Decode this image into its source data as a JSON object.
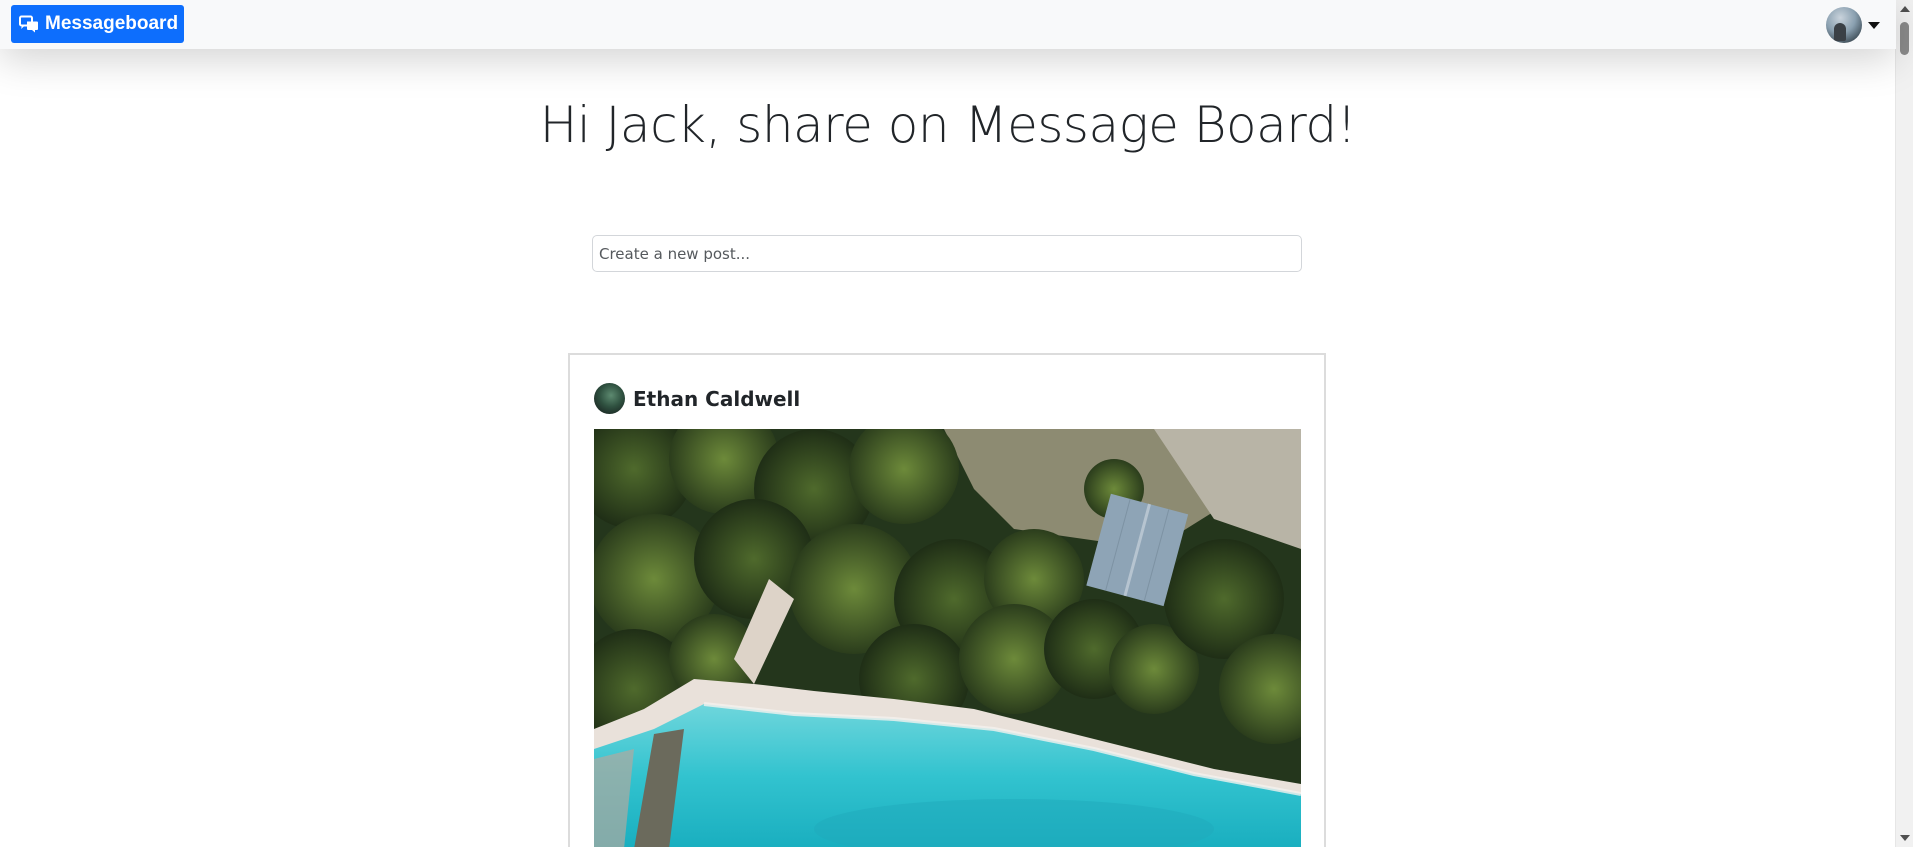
{
  "navbar": {
    "brand_label": "Messageboard",
    "brand_icon": "chat-bubbles-icon",
    "user_avatar": "user-avatar-icon",
    "menu_icon": "caret-down-icon"
  },
  "headline": "Hi Jack, share on Message Board!",
  "composer": {
    "placeholder": "Create a new post...",
    "value": ""
  },
  "feed": {
    "posts": [
      {
        "author": "Ethan Caldwell",
        "image_description": "aerial-beach-photo"
      }
    ]
  },
  "colors": {
    "brand": "#0d6efd",
    "navbar_bg": "#f8f9fa",
    "text": "#212529"
  }
}
